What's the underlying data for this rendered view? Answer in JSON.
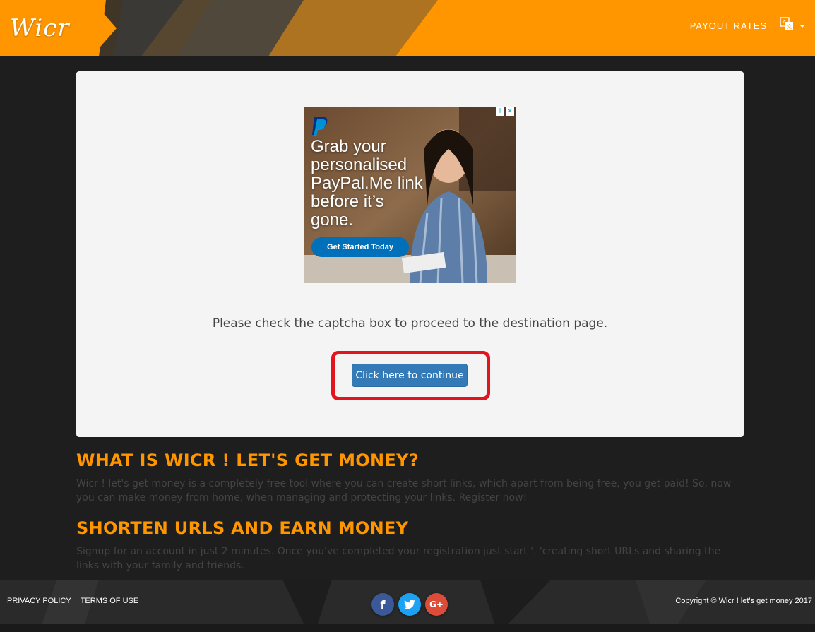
{
  "header": {
    "logo_text": "Wicr",
    "nav_payout_rates": "PAYOUT RATES",
    "language_icon": "translate-icon"
  },
  "ad": {
    "headline": "Grab your personalised PayPal.Me link before it’s gone.",
    "cta_label": "Get Started Today",
    "brand_icon": "paypal-logo",
    "choices_info": "i",
    "choices_close": "✕"
  },
  "captcha": {
    "message": "Please check the captcha box to proceed to the destination page.",
    "continue_label": "Click here to continue",
    "highlight_color": "#e2141e"
  },
  "sections": [
    {
      "title": "WHAT IS WICR ! LET'S GET MONEY?",
      "text": "Wicr ! let's get money is a completely free tool where you can create short links, which apart from being free, you get paid! So, now you can make money from home, when managing and protecting your links. Register now!"
    },
    {
      "title": "SHORTEN URLS AND EARN MONEY",
      "text": "Signup for an account in just 2 minutes. Once you've completed your registration just start '. 'creating short URLs and sharing the links with your family and friends."
    }
  ],
  "footer": {
    "privacy_label": "PRIVACY POLICY",
    "terms_label": "TERMS OF USE",
    "social": [
      {
        "name": "facebook",
        "glyph": "f",
        "color": "#3b5998"
      },
      {
        "name": "twitter",
        "glyph": "t",
        "color": "#1da1f2"
      },
      {
        "name": "google-plus",
        "glyph": "G+",
        "color": "#dd4b39"
      }
    ],
    "copyright": "Copyright © Wicr ! let's get money 2017"
  },
  "colors": {
    "brand_orange": "#ff9600",
    "button_blue": "#337ab7",
    "page_bg": "#1e1e1e"
  }
}
